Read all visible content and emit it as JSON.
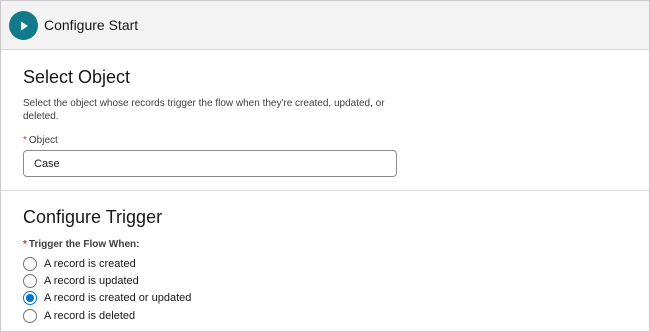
{
  "header": {
    "title": "Configure Start",
    "icon": "play-icon",
    "icon_color": "#127a8a"
  },
  "select_object": {
    "title": "Select Object",
    "description": "Select the object whose records trigger the flow when they're created, updated, or deleted.",
    "field_required_marker": "*",
    "field_label": "Object",
    "field_value": "Case"
  },
  "configure_trigger": {
    "title": "Configure Trigger",
    "required_marker": "*",
    "label": "Trigger the Flow When:",
    "options": [
      {
        "label": "A record is created",
        "selected": false
      },
      {
        "label": "A record is updated",
        "selected": false
      },
      {
        "label": "A record is created or updated",
        "selected": true
      },
      {
        "label": "A record is deleted",
        "selected": false
      }
    ]
  },
  "colors": {
    "accent": "#0176d3",
    "required": "#c23934"
  }
}
